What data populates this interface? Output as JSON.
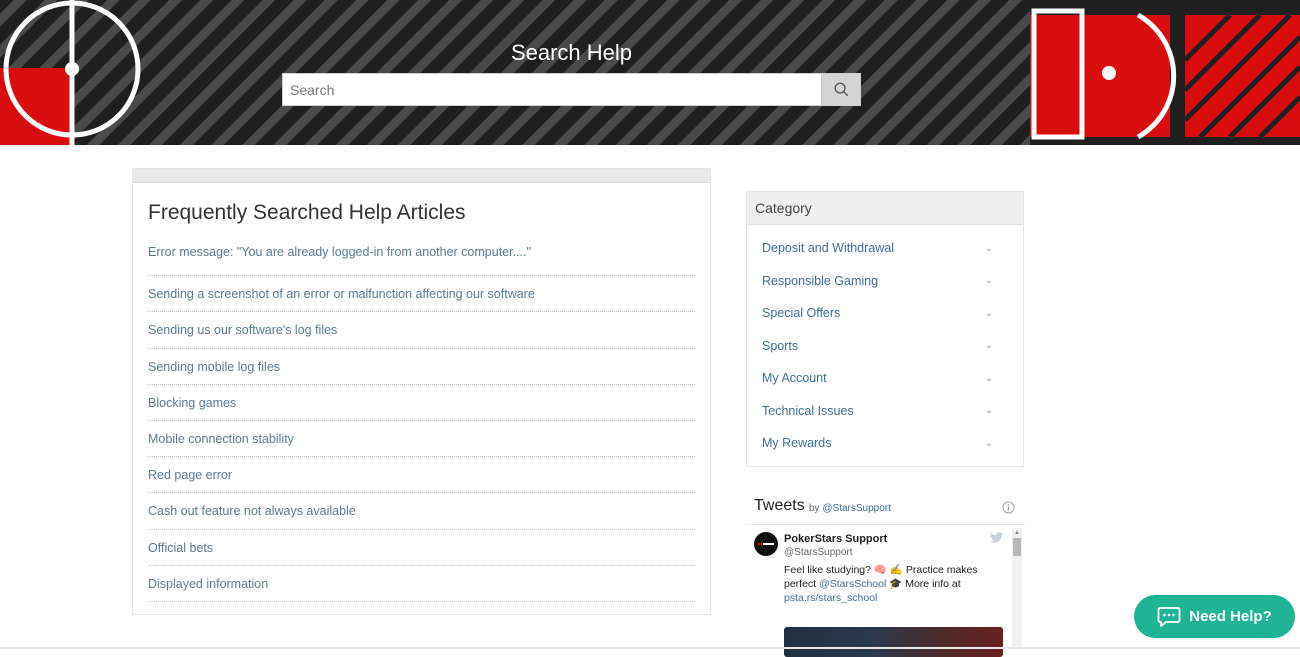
{
  "hero": {
    "title": "Search Help",
    "search_placeholder": "Search"
  },
  "articles": {
    "title": "Frequently Searched Help Articles",
    "items": [
      "Error message: \"You are already logged-in from another computer....\"",
      "Sending a screenshot of an error or malfunction affecting our software",
      "Sending us our software's log files",
      "Sending mobile log files",
      "Blocking games",
      "Mobile connection stability",
      "Red page error",
      "Cash out feature not always available",
      "Official bets",
      "Displayed information"
    ]
  },
  "category": {
    "title": "Category",
    "items": [
      "Deposit and Withdrawal",
      "Responsible Gaming",
      "Special Offers",
      "Sports",
      "My Account",
      "Technical Issues",
      "My Rewards"
    ]
  },
  "tweets": {
    "title": "Tweets",
    "by": "by",
    "by_handle": "@StarsSupport",
    "tweet": {
      "name": "PokerStars Support",
      "handle": "@StarsSupport",
      "text_part1": "Feel like studying? 🧠 ✍ Practice makes perfect",
      "mention": "@StarsSchool",
      "text_part2": "🎓 More info at",
      "link": "psta.rs/stars_school"
    }
  },
  "need_help": {
    "label": "Need Help?"
  },
  "colors": {
    "accent_red": "#d90d0d",
    "link_blue": "#3f6e94",
    "teal": "#1fb496"
  },
  "icons": [
    "search-icon",
    "chevron-down-icon",
    "info-icon",
    "twitter-bird-icon",
    "chat-icon"
  ]
}
